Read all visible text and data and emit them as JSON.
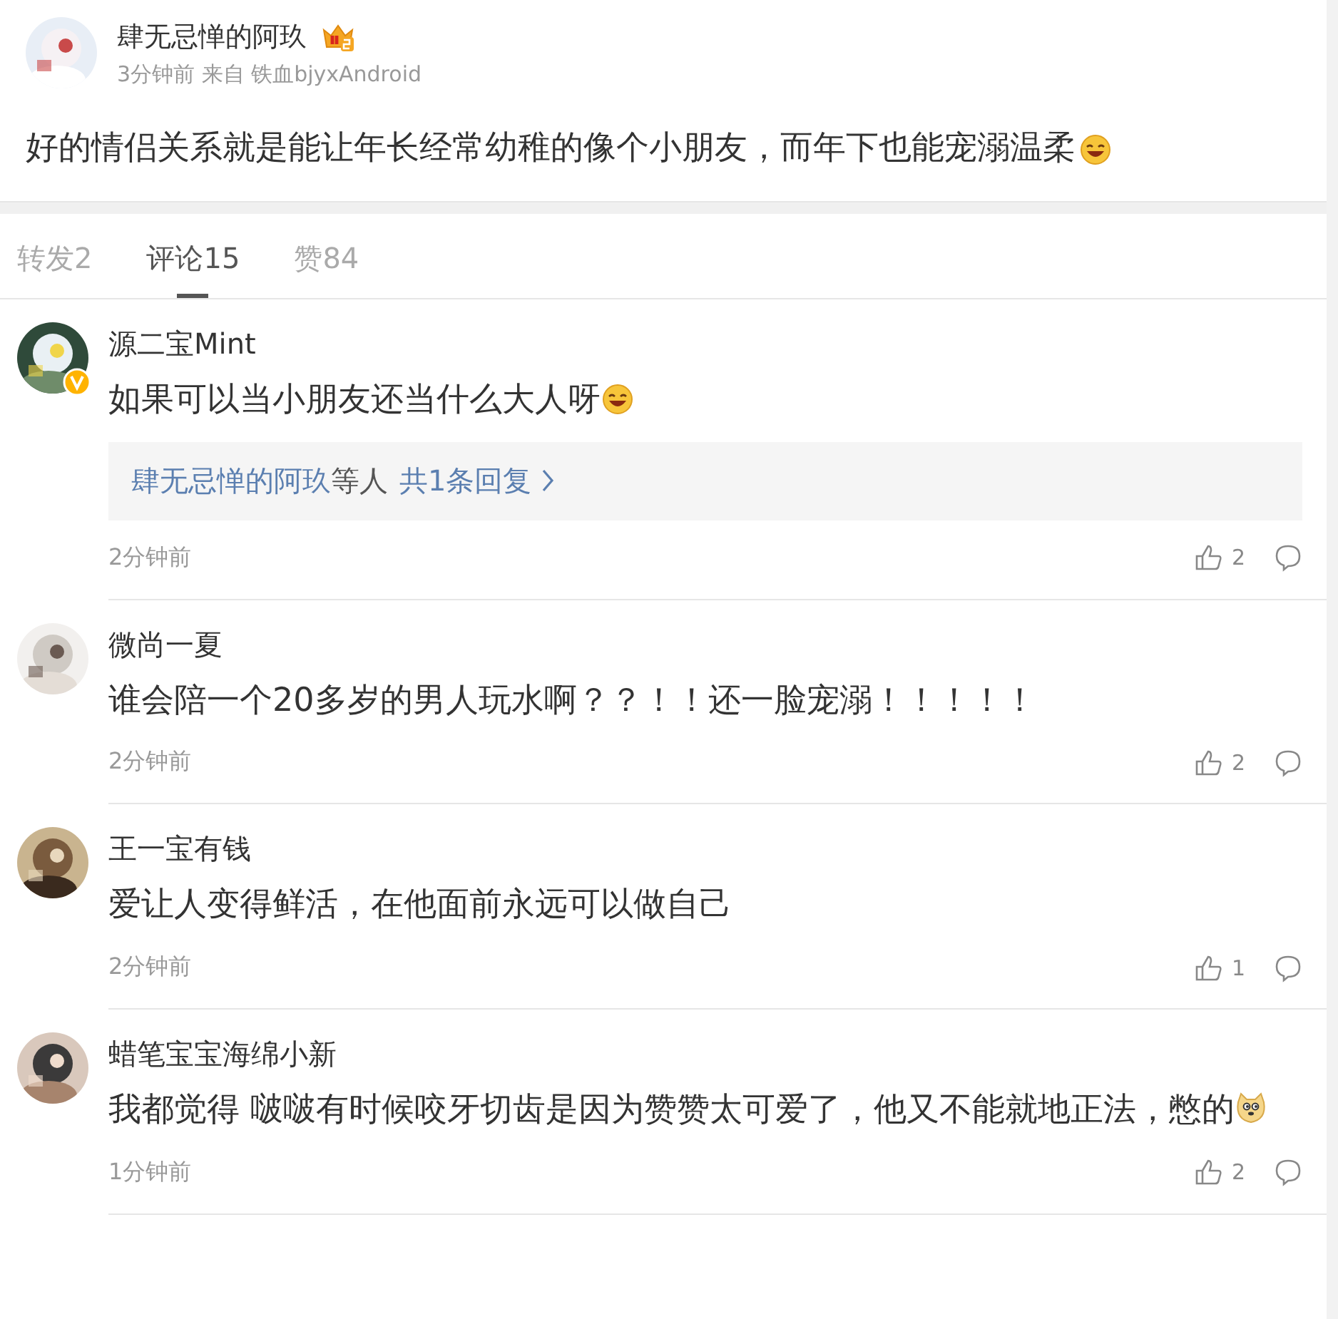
{
  "post": {
    "author": "肆无忌惮的阿玖",
    "vip": true,
    "meta": "3分钟前 来自 铁血bjyxAndroid",
    "text": "好的情侣关系就是能让年长经常幼稚的像个小朋友，而年下也能宠溺温柔",
    "emoji": {
      "kind": "grin"
    }
  },
  "tabs": [
    {
      "label": "转发2",
      "selected": false
    },
    {
      "label": "评论15",
      "selected": true
    },
    {
      "label": "赞84",
      "selected": false
    }
  ],
  "comments": [
    {
      "name": "源二宝Mint",
      "verified": true,
      "text": "如果可以当小朋友还当什么大人呀",
      "emoji": {
        "kind": "grin"
      },
      "reply": {
        "users": "肆无忌惮的阿玖",
        "suffix": "等人",
        "count": "共1条回复"
      },
      "time": "2分钟前",
      "likes": "2"
    },
    {
      "name": "微尚一夏",
      "verified": false,
      "text": "谁会陪一个20多岁的男人玩水啊？？！！还一脸宠溺！！！！！",
      "time": "2分钟前",
      "likes": "2"
    },
    {
      "name": "王一宝有钱",
      "verified": false,
      "text": "爱让人变得鲜活，在他面前永远可以做自己",
      "time": "2分钟前",
      "likes": "1"
    },
    {
      "name": "蜡笔宝宝海绵小新",
      "verified": false,
      "text": "我都觉得 啵啵有时候咬牙切齿是因为赞赞太可爱了，他又不能就地正法，憋的",
      "emoji": {
        "kind": "doge"
      },
      "time": "1分钟前",
      "likes": "2"
    }
  ]
}
